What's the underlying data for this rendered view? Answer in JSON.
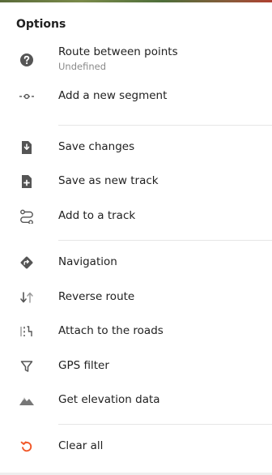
{
  "header": {
    "title": "Options"
  },
  "items": [
    {
      "label": "Route between points",
      "sublabel": "Undefined",
      "icon": "question-circle-icon"
    },
    {
      "label": "Add a new segment",
      "icon": "segment-icon"
    },
    {
      "label": "Save changes",
      "icon": "save-icon"
    },
    {
      "label": "Save as new track",
      "icon": "file-add-icon"
    },
    {
      "label": "Add to a track",
      "icon": "track-icon"
    },
    {
      "label": "Navigation",
      "icon": "navigation-icon"
    },
    {
      "label": "Reverse route",
      "icon": "reverse-icon"
    },
    {
      "label": "Attach to the roads",
      "icon": "roads-icon"
    },
    {
      "label": "GPS filter",
      "icon": "filter-icon"
    },
    {
      "label": "Get elevation data",
      "icon": "elevation-icon"
    },
    {
      "label": "Clear all",
      "icon": "reset-icon"
    }
  ],
  "colors": {
    "icon": "#555555",
    "accent": "#f1592a",
    "divider": "#e6e6e6"
  }
}
